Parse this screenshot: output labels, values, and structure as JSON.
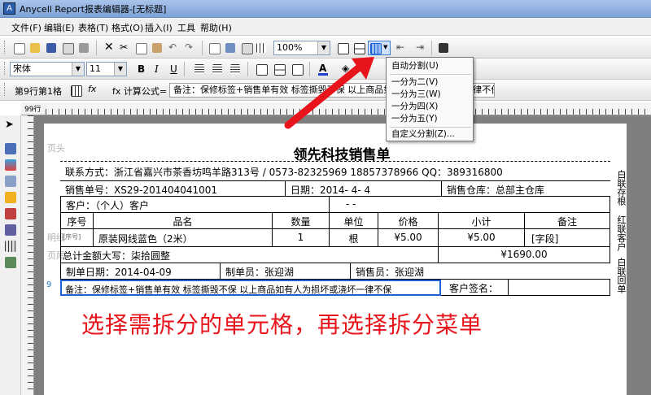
{
  "window": {
    "title": "Anycell Report报表编辑器-[无标题]"
  },
  "menubar": [
    "文件(F)",
    "编辑(E)",
    "表格(T)",
    "格式(O)",
    "插入(I)",
    "工具",
    "帮助(H)"
  ],
  "toolbar": {
    "zoom": "100%"
  },
  "format_bar": {
    "font": "宋体",
    "size": "11"
  },
  "formula_bar": {
    "cell_ref": "第9行第1格",
    "fx_label": "fx",
    "formula_label": "fx 计算公式=",
    "content": "备注：保修标签+销售单有效 标签撕毁不保 以上商品如有人为损坏或浇坏一律不保"
  },
  "split_menu": {
    "auto": "自动分割(U)",
    "items": [
      "一分为二(V)",
      "一分为三(W)",
      "一分为四(X)",
      "一分为五(Y)"
    ],
    "custom": "自定义分割(Z)..."
  },
  "ruler": {
    "label": "99行"
  },
  "report": {
    "header_band": "页头",
    "detail_band": "明细",
    "footer_band": "页尾",
    "title": "领先科技销售单",
    "contact": "联系方式：浙江省嘉兴市茶香坊鸣羊路313号 / 0573-82325969 18857378966 QQ：389316800",
    "order_no": "销售单号：XS29-201404041001",
    "date": "日期：2014- 4- 4",
    "warehouse": "销售仓库：总部主仓库",
    "customer": "客户：（个人）客户",
    "customer_tail": "- -",
    "headers": [
      "序号",
      "品名",
      "数量",
      "单位",
      "价格",
      "小计",
      "备注"
    ],
    "row": {
      "no": "[序号]",
      "name": "原装网线蓝色（2米）",
      "qty": "1",
      "unit": "根",
      "price": "¥5.00",
      "subtotal": "¥5.00",
      "note": "[字段]"
    },
    "total_words": "总计金额大写：柒拾圆整",
    "total_amount": "¥1690.00",
    "made_date": "制单日期：2014-04-09",
    "maker": "制单员：张迎湖",
    "seller": "销售员：张迎湖",
    "remark": "备注：保修标签+销售单有效 标签撕毁不保 以上商品如有人为损坏或浇坏一律不保",
    "signature": "客户签名：",
    "side_labels": [
      "白联存根",
      "红联客户",
      "白联回单"
    ],
    "row_mark": "9"
  },
  "instruction": "选择需拆分的单元格，再选择拆分菜单",
  "colors": {
    "accent": "#e8141b",
    "selection": "#1f5fd8"
  }
}
